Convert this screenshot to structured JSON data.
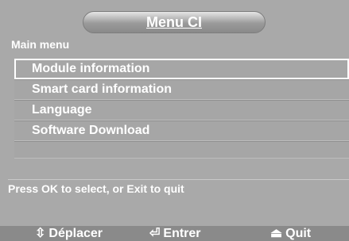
{
  "window": {
    "title": "Menu CI"
  },
  "menu": {
    "section_title": "Main menu",
    "items": [
      {
        "label": "Module information"
      },
      {
        "label": "Smart card information"
      },
      {
        "label": "Language"
      },
      {
        "label": "Software Download"
      }
    ],
    "selected_index": 0
  },
  "hint": "Press OK to select, or Exit to quit",
  "footer": {
    "move": {
      "icon": "⇳",
      "label": "Déplacer"
    },
    "enter": {
      "icon": "⏎",
      "label": "Entrer"
    },
    "quit": {
      "icon": "⏏",
      "label": "Quit"
    }
  }
}
